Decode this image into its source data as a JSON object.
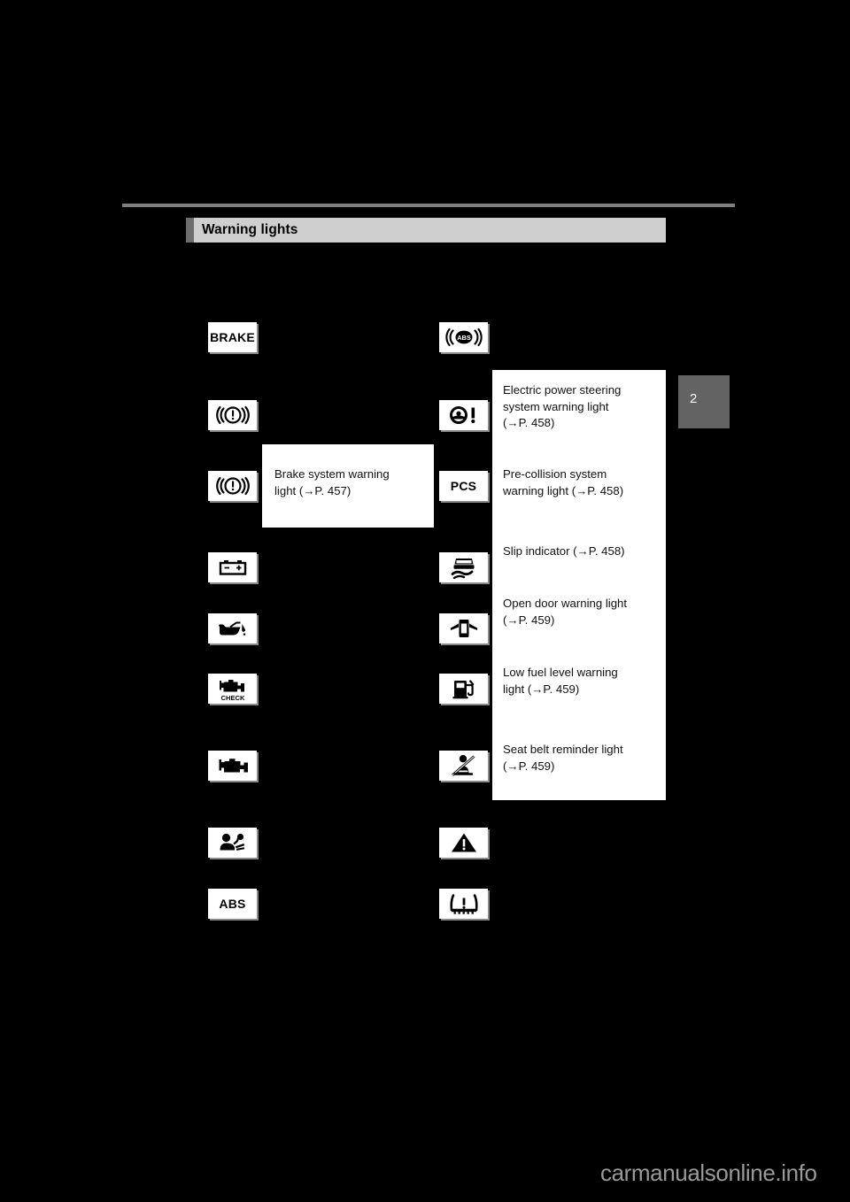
{
  "page": {
    "section_title": "Warning lights",
    "chapter_tab": "2",
    "watermark": "carmanualsonline.info"
  },
  "left_column": [
    {
      "icon": "brake-text-icon",
      "icon_text": "BRAKE"
    },
    {
      "icon": "brake-system-icon",
      "icon_text": ""
    },
    {
      "icon": "brake-system-icon",
      "icon_text": ""
    },
    {
      "icon": "battery-icon",
      "icon_text": ""
    },
    {
      "icon": "oil-pressure-icon",
      "icon_text": ""
    },
    {
      "icon": "engine-check-icon",
      "icon_text": "CHECK"
    },
    {
      "icon": "engine-icon",
      "icon_text": ""
    },
    {
      "icon": "srs-airbag-icon",
      "icon_text": ""
    },
    {
      "icon": "abs-text-icon",
      "icon_text": "ABS"
    }
  ],
  "right_column": [
    {
      "icon": "abs-brackets-icon",
      "icon_text": ""
    },
    {
      "icon": "electric-power-steering-icon",
      "icon_text": ""
    },
    {
      "icon": "pcs-text-icon",
      "icon_text": "PCS"
    },
    {
      "icon": "slip-indicator-icon",
      "icon_text": ""
    },
    {
      "icon": "open-door-icon",
      "icon_text": ""
    },
    {
      "icon": "low-fuel-icon",
      "icon_text": ""
    },
    {
      "icon": "seat-belt-reminder-icon",
      "icon_text": ""
    },
    {
      "icon": "warning-triangle-icon",
      "icon_text": ""
    },
    {
      "icon": "tire-pressure-icon",
      "icon_text": ""
    }
  ],
  "labels": {
    "brake_system": {
      "line1": "Brake system warning",
      "line2": "light (→P. 457)"
    },
    "electric_power_steering": {
      "line1": "Electric power steering",
      "line2": "system warning light",
      "line3": "(→P. 458)"
    },
    "pre_collision": {
      "line1": "Pre-collision system",
      "line2": "warning light (→P. 458)"
    },
    "slip_indicator": {
      "line1": "Slip indicator (→P. 458)"
    },
    "open_door": {
      "line1": "Open door warning light",
      "line2": "(→P. 459)"
    },
    "low_fuel": {
      "line1": "Low fuel level warning",
      "line2": "light (→P. 459)"
    },
    "seat_belt": {
      "line1": "Seat belt reminder light",
      "line2": "(→P. 459)"
    }
  },
  "colors": {
    "background": "#000000",
    "panel": "#ffffff",
    "header_bar": "#cfcfcf",
    "header_accent": "#6e6e6e",
    "rule": "#808080",
    "tab": "#636363",
    "watermark": "#9a9a9a"
  }
}
